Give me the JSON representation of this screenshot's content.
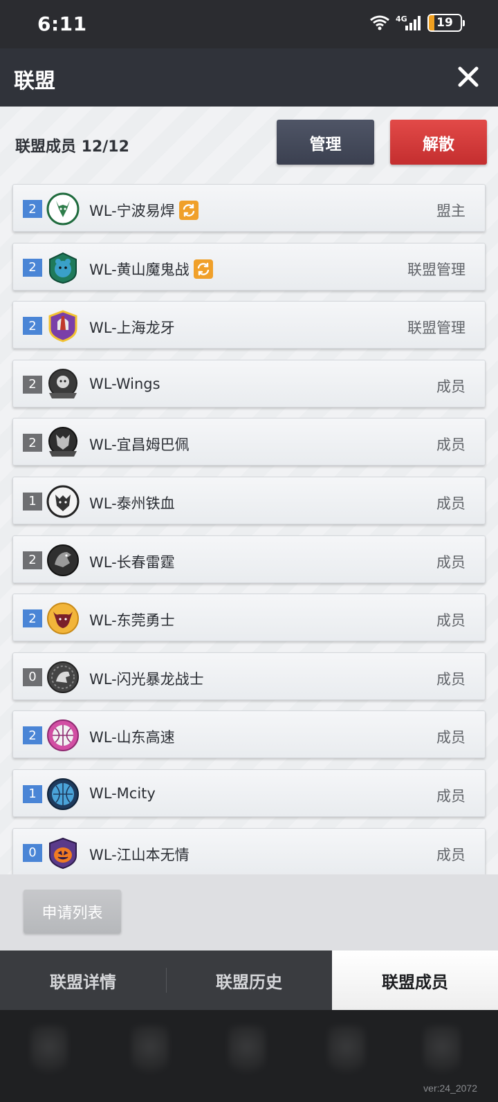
{
  "status_bar": {
    "time": "6:11",
    "battery": "19",
    "network": "4G"
  },
  "header": {
    "title": "联盟",
    "close_icon": "close-icon"
  },
  "panel": {
    "members_count": "联盟成员 12/12",
    "manage_label": "管理",
    "disband_label": "解散"
  },
  "members": [
    {
      "level": "2",
      "name": "WL-宁波易焊",
      "role": "盟主",
      "switch": true,
      "badge_color": "blue"
    },
    {
      "level": "2",
      "name": "WL-黄山魔鬼战",
      "role": "联盟管理",
      "switch": true,
      "badge_color": "blue"
    },
    {
      "level": "2",
      "name": "WL-上海龙牙",
      "role": "联盟管理",
      "switch": false,
      "badge_color": "blue"
    },
    {
      "level": "2",
      "name": "WL-Wings",
      "role": "成员",
      "switch": false,
      "badge_color": "gray"
    },
    {
      "level": "2",
      "name": "WL-宜昌姆巴佩",
      "role": "成员",
      "switch": false,
      "badge_color": "gray"
    },
    {
      "level": "1",
      "name": "WL-泰州铁血",
      "role": "成员",
      "switch": false,
      "badge_color": "gray"
    },
    {
      "level": "2",
      "name": "WL-长春雷霆",
      "role": "成员",
      "switch": false,
      "badge_color": "gray"
    },
    {
      "level": "2",
      "name": "WL-东莞勇士",
      "role": "成员",
      "switch": false,
      "badge_color": "blue"
    },
    {
      "level": "0",
      "name": "WL-闪光暴龙战士",
      "role": "成员",
      "switch": false,
      "badge_color": "gray"
    },
    {
      "level": "2",
      "name": "WL-山东高速",
      "role": "成员",
      "switch": false,
      "badge_color": "blue"
    },
    {
      "level": "1",
      "name": "WL-Mcity",
      "role": "成员",
      "switch": false,
      "badge_color": "blue"
    },
    {
      "level": "0",
      "name": "WL-江山本无情",
      "role": "成员",
      "switch": false,
      "badge_color": "blue"
    }
  ],
  "apply_list_label": "申请列表",
  "tabs": [
    {
      "label": "联盟详情"
    },
    {
      "label": "联盟历史"
    },
    {
      "label": "联盟成员",
      "active": true
    }
  ],
  "version": "ver:24_2072",
  "colors": {
    "level_blue": "#4a85d6",
    "level_gray": "#6e6f72",
    "disband_red": "#d63b3b",
    "switch_orange": "#f0a02a"
  }
}
